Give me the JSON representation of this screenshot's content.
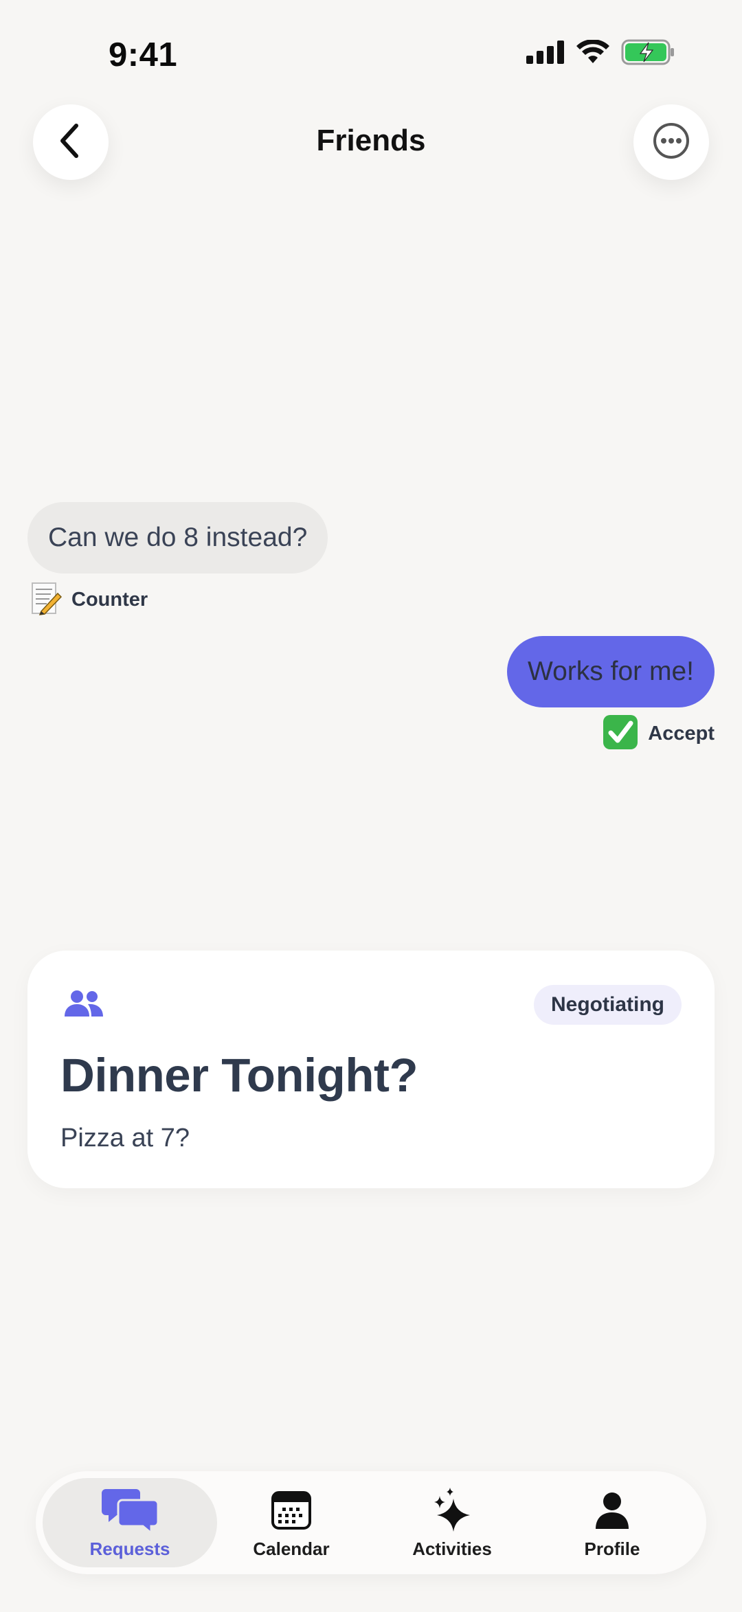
{
  "status_bar": {
    "time": "9:41",
    "icons": [
      "cellular-icon",
      "wifi-icon",
      "battery-charging-icon"
    ],
    "battery_color": "#34c759"
  },
  "header": {
    "title": "Friends",
    "back_icon": "chevron-left-icon",
    "more_icon": "ellipsis-circle-icon"
  },
  "messages": [
    {
      "direction": "incoming",
      "text": "Can we do 8 instead?",
      "reaction": {
        "emoji": "📝",
        "label": "Counter"
      }
    },
    {
      "direction": "outgoing",
      "text": "Works for me!",
      "reaction": {
        "emoji": "✅",
        "label": "Accept"
      }
    }
  ],
  "card": {
    "icon": "people-icon",
    "status": "Negotiating",
    "title": "Dinner Tonight?",
    "subtitle": "Pizza at 7?"
  },
  "tabbar": {
    "tabs": [
      {
        "label": "Requests",
        "icon": "chat-bubbles-icon",
        "active": true
      },
      {
        "label": "Calendar",
        "icon": "calendar-icon",
        "active": false
      },
      {
        "label": "Activities",
        "icon": "sparkles-icon",
        "active": false
      },
      {
        "label": "Profile",
        "icon": "person-icon",
        "active": false
      }
    ]
  },
  "colors": {
    "accent": "#6367e8",
    "background": "#f7f6f4",
    "incoming_bubble": "#ebeae8"
  }
}
